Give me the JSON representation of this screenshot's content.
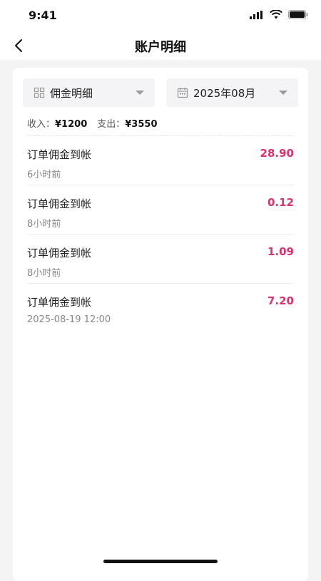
{
  "status_bar": {
    "time": "9:41"
  },
  "header": {
    "title": "账户明细"
  },
  "filters": {
    "type_label": "佣金明细",
    "month_label": "2025年08月"
  },
  "summary": {
    "income_label": "收入：",
    "income_value": "¥1200",
    "expense_label": "支出：",
    "expense_value": "¥3550"
  },
  "records": [
    {
      "title": "订单佣金到帐",
      "time": "6小时前",
      "amount": "28.90"
    },
    {
      "title": "订单佣金到帐",
      "time": "8小时前",
      "amount": "0.12"
    },
    {
      "title": "订单佣金到帐",
      "time": "8小时前",
      "amount": "1.09"
    },
    {
      "title": "订单佣金到帐",
      "time": "2025-08-19 12:00",
      "amount": "7.20"
    }
  ],
  "colors": {
    "amount": "#e0306a",
    "background": "#f4f4f4",
    "card": "#ffffff"
  },
  "icons": {
    "back": "chevron-left-icon",
    "type_filter": "grid-icon",
    "month_filter": "calendar-icon",
    "dropdown": "caret-down-icon"
  }
}
